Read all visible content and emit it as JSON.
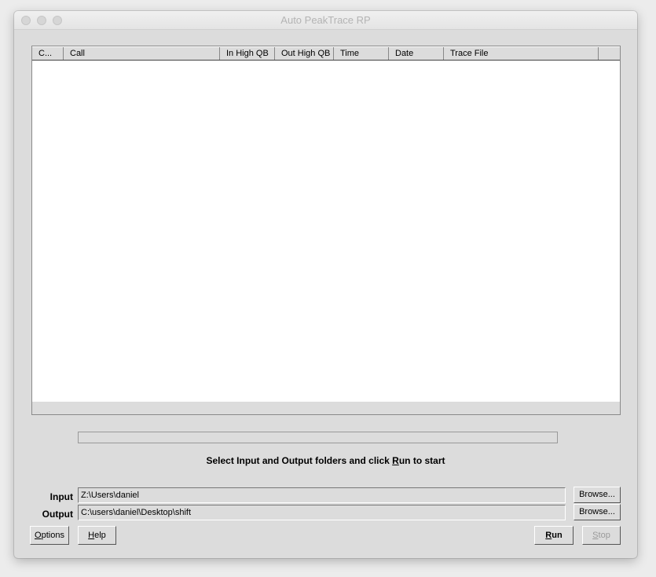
{
  "window": {
    "title": "Auto PeakTrace RP"
  },
  "table": {
    "columns": [
      "C...",
      "Call",
      "In High QB",
      "Out High QB",
      "Time",
      "Date",
      "Trace File",
      ""
    ],
    "rows": []
  },
  "progress": {
    "value": 0
  },
  "status": {
    "pre": "Select Input and Output folders and click ",
    "mnemonic": "R",
    "post": "un to start"
  },
  "input": {
    "label": "Input",
    "value": "Z:\\Users\\daniel",
    "browse": "Browse..."
  },
  "output": {
    "label": "Output",
    "value": "C:\\users\\daniel\\Desktop\\shift",
    "browse": "Browse..."
  },
  "buttons": {
    "options": "Options",
    "help": "Help",
    "run": "Run",
    "stop": "Stop"
  }
}
